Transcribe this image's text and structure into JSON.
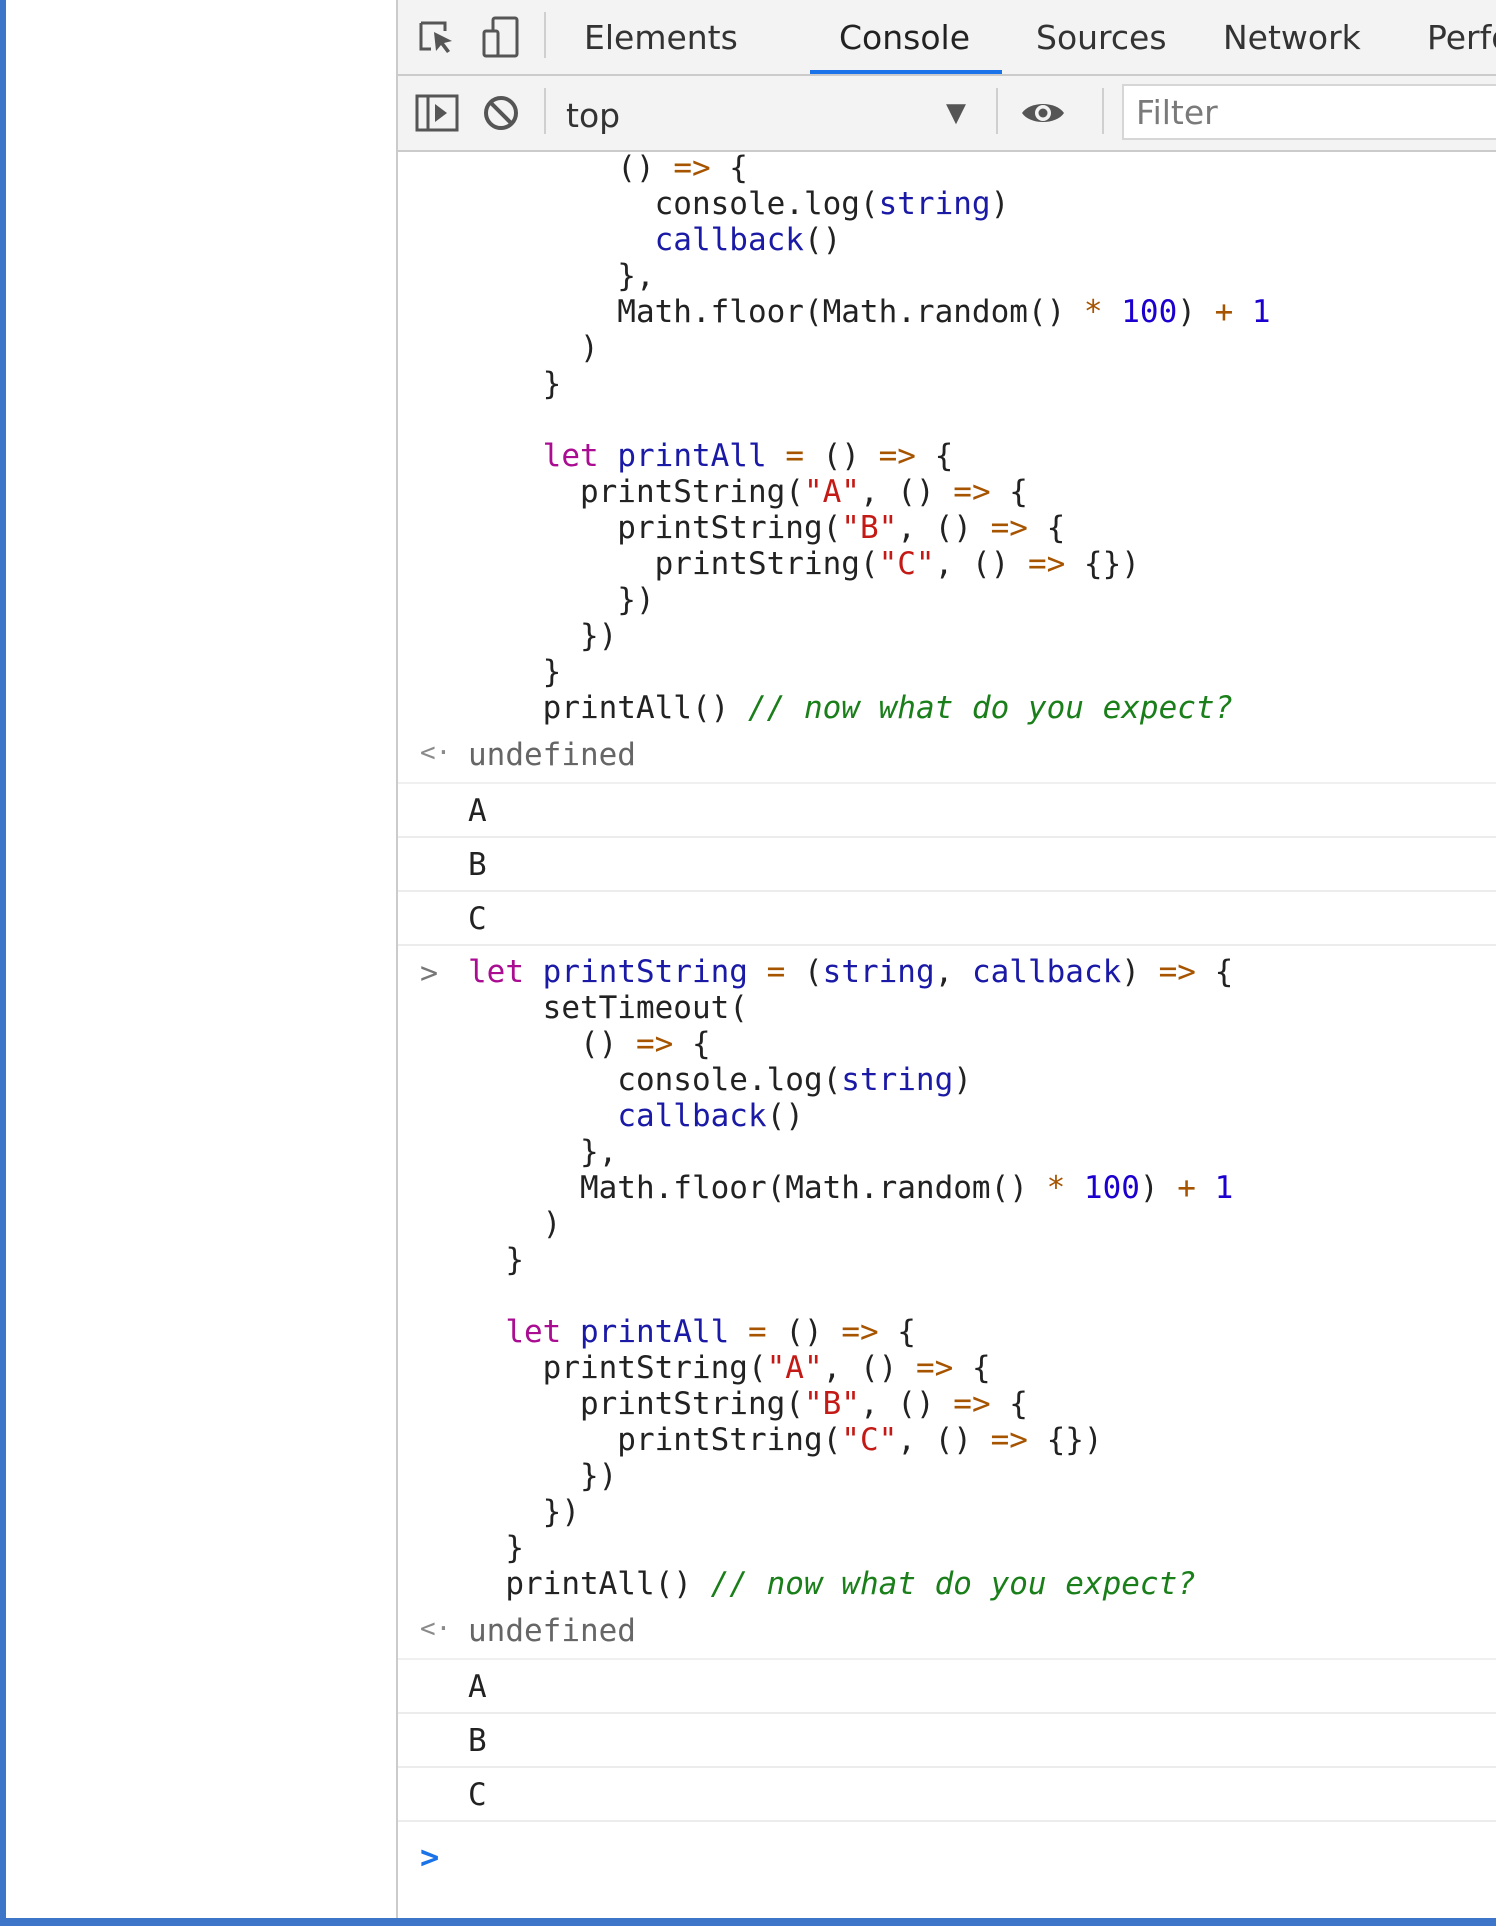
{
  "tabs": {
    "elements": "Elements",
    "console": "Console",
    "sources": "Sources",
    "network": "Network",
    "performance": "Perfo"
  },
  "toolbar": {
    "context": "top",
    "filter_placeholder": "Filter"
  },
  "console": {
    "return_value": "undefined",
    "logs_first": [
      "A",
      "B",
      "C"
    ],
    "logs_second": [
      "A",
      "B",
      "C"
    ]
  },
  "icons": {
    "inspect": "element-picker-icon",
    "device": "device-toolbar-icon",
    "sidebar": "show-sidebar-icon",
    "clear": "clear-console-icon",
    "eye": "live-expression-eye-icon",
    "dropdown": "dropdown-triangle-icon",
    "prompt": "console-prompt-chevron-icon",
    "return": "return-value-arrow-icon"
  },
  "colors": {
    "accent": "#1a73e8",
    "frame": "#3d75c9",
    "keyword": "#aa0d91",
    "string": "#c41a16",
    "number": "#1c00cf",
    "comment": "#1a7f1a"
  }
}
